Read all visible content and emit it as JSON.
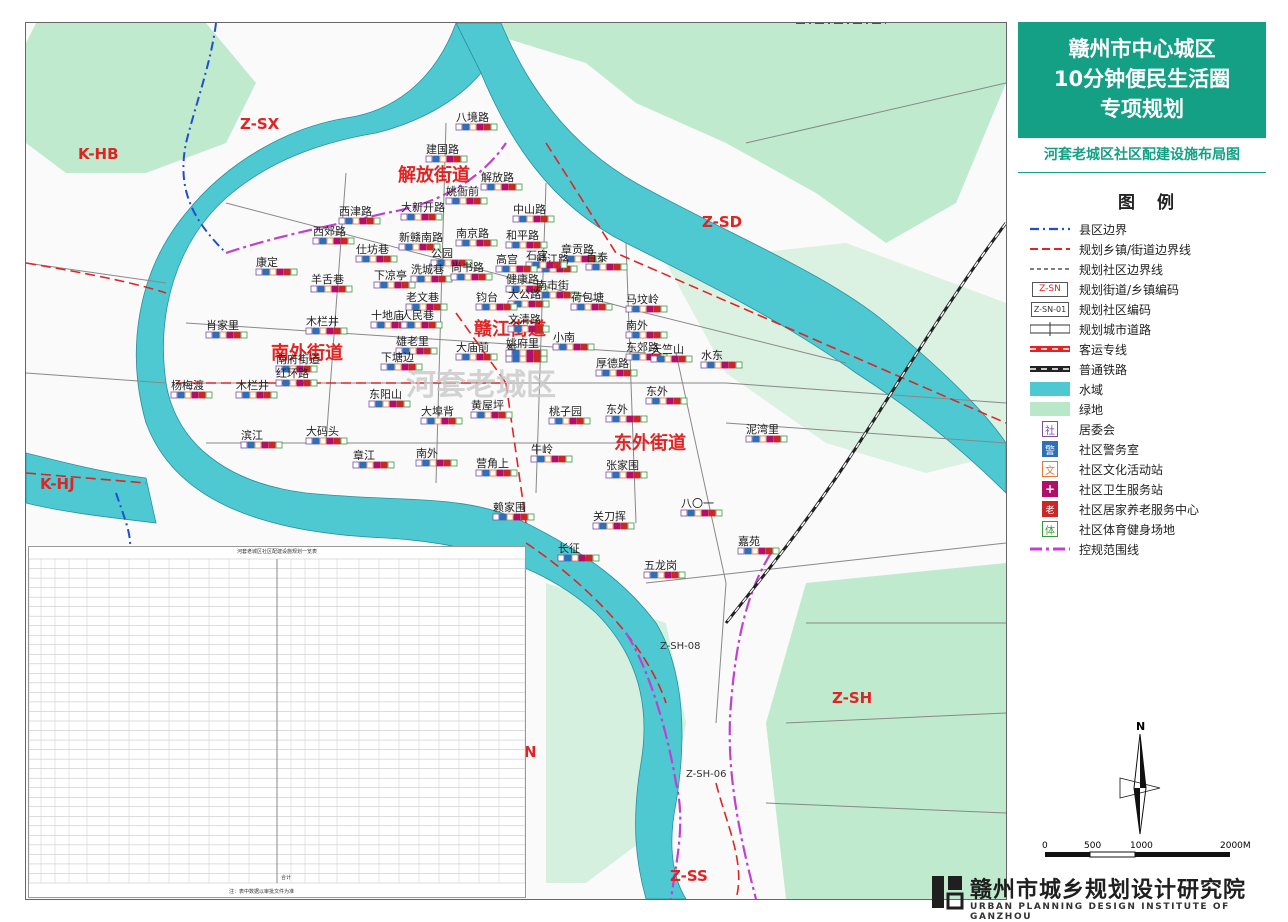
{
  "title": {
    "line1": "赣州市中心城区",
    "line2": "10分钟便民生活圈",
    "line3": "专项规划",
    "subtitle": "河套老城区社区配建设施布局图"
  },
  "legend": {
    "heading": "图 例",
    "items": [
      {
        "label": "县区边界",
        "symbol": "county-boundary-line"
      },
      {
        "label": "规划乡镇/街道边界线",
        "symbol": "street-boundary-line"
      },
      {
        "label": "规划社区边界线",
        "symbol": "community-boundary-line"
      },
      {
        "label": "规划街道/乡镇编码",
        "symbol": "street-code-box",
        "sample": "Z-SN"
      },
      {
        "label": "规划社区编码",
        "symbol": "community-code-box",
        "sample": "Z-SN-01"
      },
      {
        "label": "规划城市道路",
        "symbol": "road"
      },
      {
        "label": "客运专线",
        "symbol": "passenger-rail"
      },
      {
        "label": "普通铁路",
        "symbol": "railway"
      },
      {
        "label": "水域",
        "symbol": "water",
        "color": "#4ec9d2"
      },
      {
        "label": "绿地",
        "symbol": "green",
        "color": "#b8e8c8"
      },
      {
        "label": "居委会",
        "symbol": "icon",
        "glyph": "社",
        "color": "#7a4fa0"
      },
      {
        "label": "社区警务室",
        "symbol": "icon",
        "glyph": "警",
        "color": "#2f6fb8"
      },
      {
        "label": "社区文化活动站",
        "symbol": "icon",
        "glyph": "文",
        "color": "#e07a3a"
      },
      {
        "label": "社区卫生服务站",
        "symbol": "icon",
        "glyph": "+",
        "color": "#b0106a"
      },
      {
        "label": "社区居家养老服务中心",
        "symbol": "icon",
        "glyph": "老",
        "color": "#c82828"
      },
      {
        "label": "社区体育健身场地",
        "symbol": "icon",
        "glyph": "体",
        "color": "#3a9a3a"
      },
      {
        "label": "控规范围线",
        "symbol": "control-range-line",
        "color": "#c040d0"
      }
    ]
  },
  "map": {
    "watermark": "河套老城区",
    "district_codes": [
      "K-HB",
      "Z-SX",
      "Z-SD",
      "K-HJ",
      "Z-SH",
      "Z-SS",
      "N"
    ],
    "community_codes": [
      "Z-SH-08",
      "Z-SH-06"
    ],
    "streets": [
      "解放街道",
      "赣江街道",
      "南外街道",
      "东外街道"
    ],
    "communities": [
      "八境路",
      "建国路",
      "解放路",
      "姚衙前",
      "西津路",
      "大新开路",
      "中山路",
      "西郊路",
      "仕坊巷",
      "章贡路",
      "新赣南路",
      "南京路",
      "和平路",
      "赣江路",
      "康定",
      "公园",
      "羊舌巷",
      "下凉亭",
      "洗城巷",
      "尚书路",
      "健康路",
      "南市街",
      "百泰",
      "石宫",
      "高宫",
      "大公路",
      "荷包塘",
      "老文巷",
      "钧台",
      "文清路",
      "小南",
      "肖家里",
      "木栏井",
      "十地庙",
      "人民巷",
      "南外",
      "马坟岭",
      "东",
      "雄老里",
      "大庙前",
      "姚府里",
      "厚德路",
      "东郊路",
      "东外",
      "南府街道",
      "下塘边",
      "红环路",
      "天竺山",
      "水东",
      "杨梅渡",
      "木栏井",
      "东阳山",
      "大埠背",
      "黄屋坪",
      "桃子园",
      "泥湾里",
      "大码头",
      "滨江",
      "东外",
      "章江",
      "南外",
      "牛岭",
      "张家围",
      "营角上",
      "赖家围",
      "八〇一",
      "关刀挥",
      "嘉苑",
      "长征",
      "五龙岗"
    ],
    "scale": {
      "ticks": [
        "0",
        "500",
        "1000",
        "2000M"
      ]
    },
    "north_label": "N"
  },
  "table": {
    "title": "河套老城区社区配建设施规划一览表",
    "headers": [
      "序号",
      "社区名称",
      "社区用地面积",
      "居委会",
      "社区警务室",
      "社区文化活动站",
      "社区卫生服务站",
      "社区居家养老服务中心",
      "社区体育健身场地"
    ],
    "total_label": "合计",
    "note": "注：表中数据以审批文件为准"
  },
  "footer": {
    "org_cn": "赣州市城乡规划设计研究院",
    "org_en": "URBAN PLANNING DESIGN INSTITUTE OF GANZHOU"
  },
  "colors": {
    "accent": "#13a084",
    "water": "#4ec9d2",
    "green": "#b8e8c8",
    "street_label": "#e02424",
    "boundary_red": "#e02424",
    "county_blue": "#1f4fd0",
    "control_purple": "#c040d0"
  }
}
